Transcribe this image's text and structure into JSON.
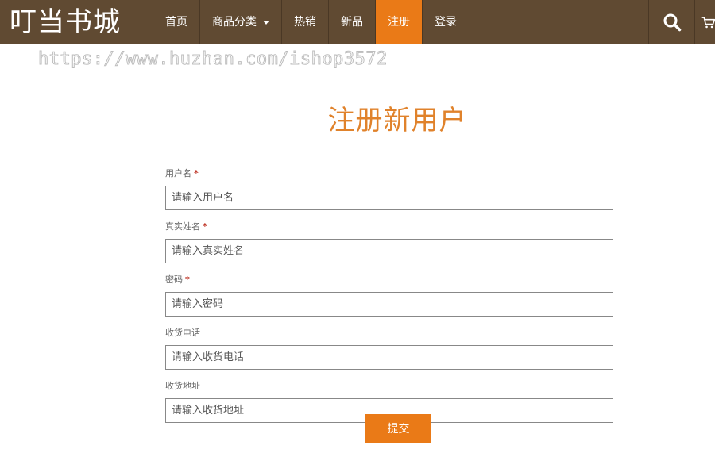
{
  "header": {
    "logo": "叮当书城",
    "nav": [
      {
        "label": "首页"
      },
      {
        "label": "商品分类"
      },
      {
        "label": "热销"
      },
      {
        "label": "新品"
      },
      {
        "label": "注册"
      },
      {
        "label": "登录"
      }
    ],
    "active_index": 4,
    "accent_color": "#ea7a17",
    "bar_color": "#604a32"
  },
  "watermark": "https://www.huzhan.com/ishop3572",
  "page": {
    "title": "注册新用户"
  },
  "form": {
    "fields": [
      {
        "label": "用户名",
        "required_mark": "*",
        "placeholder": "请输入用户名"
      },
      {
        "label": "真实姓名",
        "required_mark": "*",
        "placeholder": "请输入真实姓名"
      },
      {
        "label": "密码",
        "required_mark": "*",
        "placeholder": "请输入密码"
      },
      {
        "label": "收货电话",
        "placeholder": "请输入收货电话"
      },
      {
        "label": "收货地址",
        "placeholder": "请输入收货地址"
      }
    ],
    "submit_label": "提交"
  },
  "icons": {
    "search": "search-icon",
    "cart": "cart-icon"
  }
}
